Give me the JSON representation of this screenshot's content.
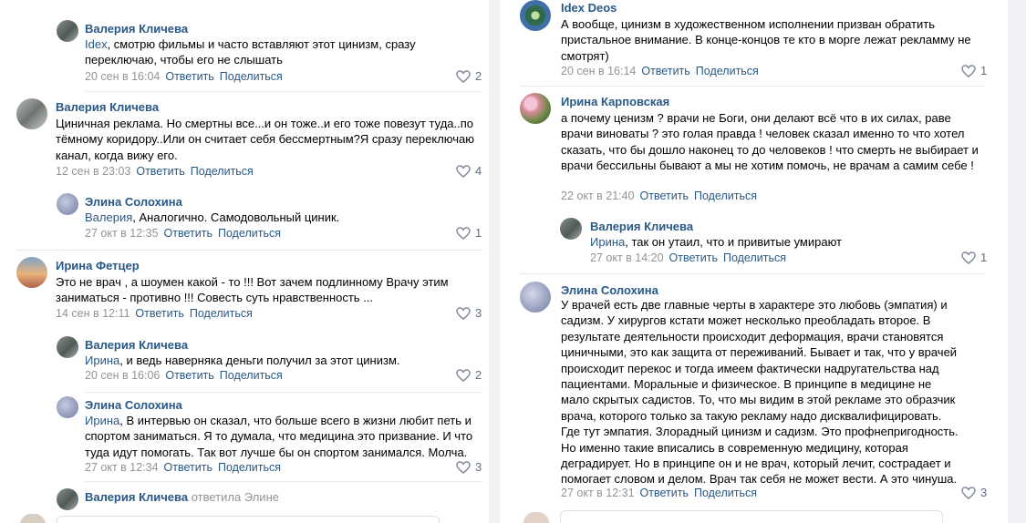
{
  "left": {
    "c1": {
      "name": "Валерия Кличева",
      "addr": "Idex",
      "text": ", смотрю фильмы и часто вставляют этот цинизм, сразу переключаю, чтобы его не слышать",
      "date": "20 сен в 16:04",
      "reply": "Ответить",
      "share": "Поделиться",
      "likes": "2"
    },
    "c2": {
      "name": "Валерия Кличева",
      "text": "Циничная реклама. Но смертны все...и он тоже..и его тоже повезут туда..по тёмному коридору..Или он считает себя бессмертным?Я сразу переключаю канал, когда вижу его.",
      "date": "12 сен в 23:03",
      "reply": "Ответить",
      "share": "Поделиться",
      "likes": "4"
    },
    "c3": {
      "name": "Элина Солохина",
      "addr": "Валерия",
      "text": ", Аналогично. Самодовольный циник.",
      "date": "27 окт в 12:35",
      "reply": "Ответить",
      "share": "Поделиться",
      "likes": "1"
    },
    "c4": {
      "name": "Ирина Фетцер",
      "text": "Это не врач , а шоумен какой - то !!! Вот зачем подлинному Врачу этим заниматься - противно !!! Совесть суть нравственность ...",
      "date": "14 сен в 12:11",
      "reply": "Ответить",
      "share": "Поделиться",
      "likes": "3"
    },
    "c5": {
      "name": "Валерия Кличева",
      "addr": "Ирина",
      "text": ", и ведь наверняка деньги получил за этот цинизм.",
      "date": "20 сен в 16:06",
      "reply": "Ответить",
      "share": "Поделиться",
      "likes": "2"
    },
    "c6": {
      "name": "Элина Солохина",
      "addr": "Ирина",
      "text": ", В интервью он сказал, что больше всего в жизни любит петь и спортом заниматься. Я то думала, что медицина это призвание. И что туда идут помогать. Так вот лучше бы он спортом занимался. Молча.",
      "date": "27 окт в 12:34",
      "reply": "Ответить",
      "share": "Поделиться",
      "likes": "3"
    },
    "c7": {
      "name": "Валерия Кличева",
      "sub": "ответила Элине"
    }
  },
  "right": {
    "c1": {
      "name": "Idex Deos",
      "text": "А вообще, цинизм в художественном исполнении призван обратить пристальное внимание. В конце-концов те кто в морге лежат рекламму не смотрят)",
      "date": "20 сен в 16:14",
      "reply": "Ответить",
      "share": "Поделиться",
      "likes": "1"
    },
    "c2": {
      "name": "Ирина Карповская",
      "text": "а почему ценизм ?  врачи не Боги, они делают всё что в их силах, раве врачи виноваты  ?  это голая правда !  человек сказал именно то что хотел сказать, что бы дошло наконец то до человеков !  что смерть не выбирает и врачи бессильны бывают а мы не хотим помочь, не врачам а самим себе !",
      "date": "22 окт в 21:40",
      "reply": "Ответить",
      "share": "Поделиться"
    },
    "c3": {
      "name": "Валерия Кличева",
      "addr": "Ирина",
      "text": ", так он утаил, что и привитые умирают",
      "date": "27 окт в 14:20",
      "reply": "Ответить",
      "share": "Поделиться",
      "likes": "1"
    },
    "c4": {
      "name": "Элина Солохина",
      "text": "У врачей есть две главные черты в характере это любовь (эмпатия) и садизм. У хирургов кстати может несколько преобладать второе. В результате деятельности происходит деформация, врачи становятся циничными, это как защита от переживаний. Бывает и так, что у врачей происходит перекос и тогда имеем фактически надругательства над пациентами. Моральные и физическое. В принципе в медицине не мало скрытых садистов. То, что мы видим в этой рекламе это образчик врача, которого только за такую рекламу надо дисквалифицировать. Где тут эмпатия. Злорадный цинизм и садизм. Это профнепригодность. Но именно такие вписались в современную медицину, которая деградирует. Но в принципе он и не врач, который лечит, сострадает и помогает словом и делом. Врач так себя не может вести. А это чинуша.",
      "date": "27 окт в 12:31",
      "reply": "Ответить",
      "share": "Поделиться",
      "likes": "3"
    }
  },
  "colors": {
    "link": "#2a5885",
    "meta": "#939393",
    "separator": "#e7e8ec",
    "gutter": "#f0f2f5"
  },
  "icons": {
    "like": "heart-outline-icon"
  }
}
